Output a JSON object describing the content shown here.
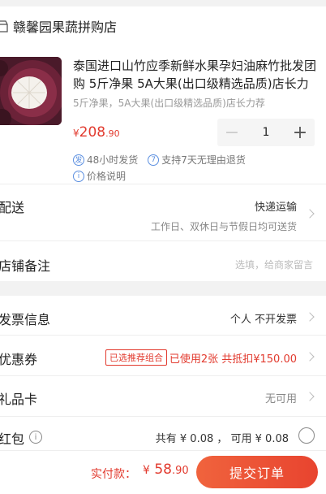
{
  "store": {
    "name": "赣馨园果蔬拼购店"
  },
  "product": {
    "title": "泰国进口山竹应季新鲜水果孕妇油麻竹批发团购 5斤净果 5A大果(出口级精选品质)店长力荐",
    "spec": "5斤净果，5A大果(出口级精选品质)店长力荐",
    "price_currency": "¥",
    "price_integer": "208",
    "price_decimal": ".90",
    "quantity": "1",
    "minus_label": "−",
    "plus_label": "+"
  },
  "services": {
    "shipping_icon": "发",
    "shipping": "48小时发货",
    "return_icon": "7",
    "return_policy": "支持7天无理由退货",
    "price_icon": "i",
    "price_note": "价格说明"
  },
  "delivery": {
    "label": "配送",
    "method": "快递运输",
    "schedule": "工作日、双休日与节假日均可送货"
  },
  "remark": {
    "label": "店铺备注",
    "placeholder": "选填，给商家留言"
  },
  "invoice": {
    "label": "发票信息",
    "value": "个人 不开发票"
  },
  "coupon": {
    "label": "优惠券",
    "badge": "已选推荐组合",
    "value": "已使用2张 共抵扣¥150.00"
  },
  "gift_card": {
    "label": "礼品卡",
    "value": "无可用"
  },
  "red_packet": {
    "label": "红包",
    "info_icon": "i",
    "value": "共有 ¥ 0.08 ， 可用 ¥ 0.08"
  },
  "footer": {
    "total_label": "实付款：",
    "total_currency": "¥",
    "total_integer": " 58",
    "total_decimal": ".90",
    "submit_label": "提交订单"
  },
  "colors": {
    "accent": "#e23a2e",
    "button_gradient_start": "#f0633d",
    "button_gradient_end": "#e8442f",
    "service_icon": "#5b8fe0"
  }
}
